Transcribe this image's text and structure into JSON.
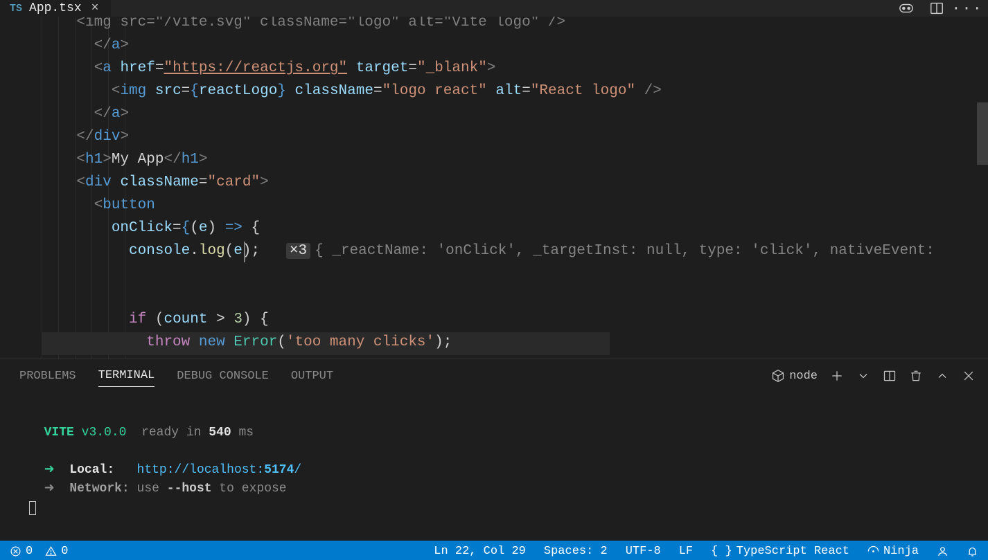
{
  "tab": {
    "lang": "TS",
    "name": "App.tsx"
  },
  "code": {
    "reactHref": "\"https://reactjs.org\"",
    "target": "\"_blank\"",
    "reactLogoVar": "reactLogo",
    "logoReactClass": "\"logo react\"",
    "reactAlt": "\"React logo\"",
    "h1Text": "My App",
    "cardClass": "\"card\"",
    "onClickParam": "e",
    "consoleObj": "console",
    "logFn": "log",
    "inlayCount": "×3",
    "inlayBody": "{ _reactName: 'onClick', _targetInst: null, type: 'click', nativeEvent:",
    "ifKw": "if",
    "countVar": "count",
    "gt": ">",
    "three": "3",
    "throwKw": "throw",
    "newKw": "new",
    "errorClass": "Error",
    "errMsg": "'too many clicks'",
    "top_img_frag": "    <img src=\"/vite.svg\" className=\"logo\" alt=\"Vite logo\" />"
  },
  "panel": {
    "tabs": {
      "problems": "PROBLEMS",
      "terminal": "TERMINAL",
      "debug": "DEBUG CONSOLE",
      "output": "OUTPUT"
    },
    "profile": "node"
  },
  "terminal": {
    "vite": "VITE",
    "version": "v3.0.0",
    "readyPrefix": "ready in ",
    "readyMs": "540",
    "readySuffix": " ms",
    "localLabel": "Local:",
    "localUrlA": "http://localhost:",
    "localUrlPort": "5174",
    "localUrlB": "/",
    "networkLabel": "Network:",
    "networkA": "use ",
    "networkFlag": "--host",
    "networkB": " to expose"
  },
  "status": {
    "errors": "0",
    "warnings": "0",
    "pos": "Ln 22, Col 29",
    "indent": "Spaces: 2",
    "encoding": "UTF-8",
    "eol": "LF",
    "language": "TypeScript React",
    "ninja": "Ninja"
  }
}
